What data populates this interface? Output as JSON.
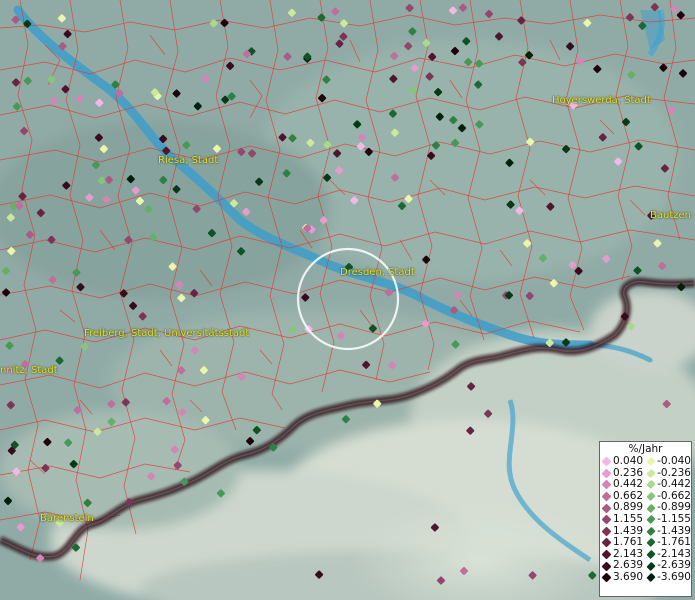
{
  "cities": [
    {
      "id": "riesa",
      "name": "Riesa, Stadt"
    },
    {
      "id": "hoyerswerda",
      "name": "Hoyerswerda, Stadt"
    },
    {
      "id": "bautzen",
      "name": "Bautzen"
    },
    {
      "id": "dresden",
      "name": "Dresden, Stadt"
    },
    {
      "id": "freiberg",
      "name": "Freiberg, Stadt, Universitätsstadt"
    },
    {
      "id": "chemnitz",
      "name": "nnitz, Stadt"
    },
    {
      "id": "baerenstein",
      "name": "Bärenstein"
    }
  ],
  "legend": {
    "title": "%/Jahr",
    "positive": [
      {
        "label": "0.040",
        "color": "#f4b8e6"
      },
      {
        "label": "0.236",
        "color": "#e39ccd"
      },
      {
        "label": "0.442",
        "color": "#d186b6"
      },
      {
        "label": "0.662",
        "color": "#bf6f9c"
      },
      {
        "label": "0.899",
        "color": "#aa5a83"
      },
      {
        "label": "1.155",
        "color": "#95466c"
      },
      {
        "label": "1.439",
        "color": "#7e3456"
      },
      {
        "label": "1.761",
        "color": "#672341"
      },
      {
        "label": "2.143",
        "color": "#50152e"
      },
      {
        "label": "2.639",
        "color": "#380a1b"
      },
      {
        "label": "3.690",
        "color": "#1e020b"
      }
    ],
    "negative": [
      {
        "label": "-0.040",
        "color": "#ecf6a8"
      },
      {
        "label": "-0.236",
        "color": "#cbe99a"
      },
      {
        "label": "-0.442",
        "color": "#a9d98a"
      },
      {
        "label": "-0.662",
        "color": "#86c678"
      },
      {
        "label": "-0.899",
        "color": "#65b066"
      },
      {
        "label": "-1.155",
        "color": "#489955"
      },
      {
        "label": "-1.439",
        "color": "#2f8143"
      },
      {
        "label": "-1.761",
        "color": "#1c6a33"
      },
      {
        "label": "-2.143",
        "color": "#0f5224"
      },
      {
        "label": "-2.639",
        "color": "#063a16"
      },
      {
        "label": "-3.690",
        "color": "#01200a"
      }
    ]
  }
}
